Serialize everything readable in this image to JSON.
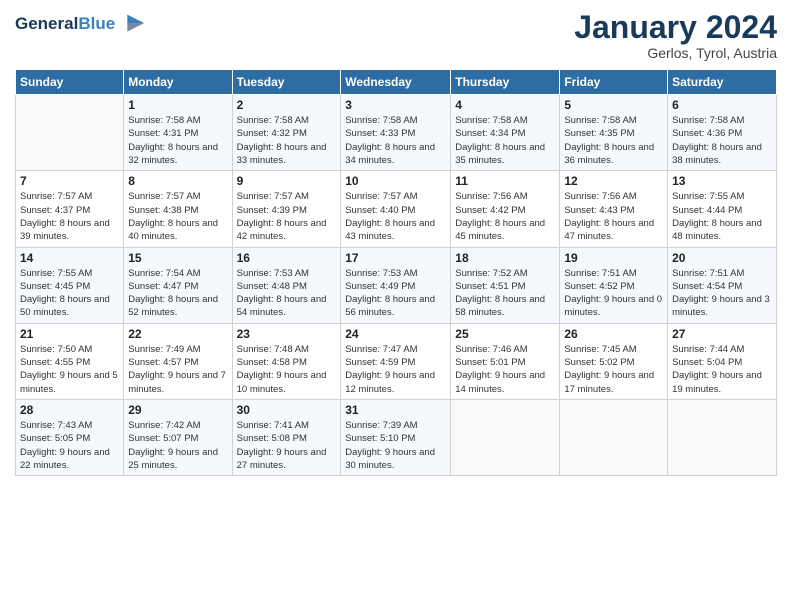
{
  "header": {
    "logo_line1": "General",
    "logo_line2": "Blue",
    "month": "January 2024",
    "location": "Gerlos, Tyrol, Austria"
  },
  "days_of_week": [
    "Sunday",
    "Monday",
    "Tuesday",
    "Wednesday",
    "Thursday",
    "Friday",
    "Saturday"
  ],
  "weeks": [
    [
      {
        "day": "",
        "sunrise": "",
        "sunset": "",
        "daylight": ""
      },
      {
        "day": "1",
        "sunrise": "Sunrise: 7:58 AM",
        "sunset": "Sunset: 4:31 PM",
        "daylight": "Daylight: 8 hours and 32 minutes."
      },
      {
        "day": "2",
        "sunrise": "Sunrise: 7:58 AM",
        "sunset": "Sunset: 4:32 PM",
        "daylight": "Daylight: 8 hours and 33 minutes."
      },
      {
        "day": "3",
        "sunrise": "Sunrise: 7:58 AM",
        "sunset": "Sunset: 4:33 PM",
        "daylight": "Daylight: 8 hours and 34 minutes."
      },
      {
        "day": "4",
        "sunrise": "Sunrise: 7:58 AM",
        "sunset": "Sunset: 4:34 PM",
        "daylight": "Daylight: 8 hours and 35 minutes."
      },
      {
        "day": "5",
        "sunrise": "Sunrise: 7:58 AM",
        "sunset": "Sunset: 4:35 PM",
        "daylight": "Daylight: 8 hours and 36 minutes."
      },
      {
        "day": "6",
        "sunrise": "Sunrise: 7:58 AM",
        "sunset": "Sunset: 4:36 PM",
        "daylight": "Daylight: 8 hours and 38 minutes."
      }
    ],
    [
      {
        "day": "7",
        "sunrise": "Sunrise: 7:57 AM",
        "sunset": "Sunset: 4:37 PM",
        "daylight": "Daylight: 8 hours and 39 minutes."
      },
      {
        "day": "8",
        "sunrise": "Sunrise: 7:57 AM",
        "sunset": "Sunset: 4:38 PM",
        "daylight": "Daylight: 8 hours and 40 minutes."
      },
      {
        "day": "9",
        "sunrise": "Sunrise: 7:57 AM",
        "sunset": "Sunset: 4:39 PM",
        "daylight": "Daylight: 8 hours and 42 minutes."
      },
      {
        "day": "10",
        "sunrise": "Sunrise: 7:57 AM",
        "sunset": "Sunset: 4:40 PM",
        "daylight": "Daylight: 8 hours and 43 minutes."
      },
      {
        "day": "11",
        "sunrise": "Sunrise: 7:56 AM",
        "sunset": "Sunset: 4:42 PM",
        "daylight": "Daylight: 8 hours and 45 minutes."
      },
      {
        "day": "12",
        "sunrise": "Sunrise: 7:56 AM",
        "sunset": "Sunset: 4:43 PM",
        "daylight": "Daylight: 8 hours and 47 minutes."
      },
      {
        "day": "13",
        "sunrise": "Sunrise: 7:55 AM",
        "sunset": "Sunset: 4:44 PM",
        "daylight": "Daylight: 8 hours and 48 minutes."
      }
    ],
    [
      {
        "day": "14",
        "sunrise": "Sunrise: 7:55 AM",
        "sunset": "Sunset: 4:45 PM",
        "daylight": "Daylight: 8 hours and 50 minutes."
      },
      {
        "day": "15",
        "sunrise": "Sunrise: 7:54 AM",
        "sunset": "Sunset: 4:47 PM",
        "daylight": "Daylight: 8 hours and 52 minutes."
      },
      {
        "day": "16",
        "sunrise": "Sunrise: 7:53 AM",
        "sunset": "Sunset: 4:48 PM",
        "daylight": "Daylight: 8 hours and 54 minutes."
      },
      {
        "day": "17",
        "sunrise": "Sunrise: 7:53 AM",
        "sunset": "Sunset: 4:49 PM",
        "daylight": "Daylight: 8 hours and 56 minutes."
      },
      {
        "day": "18",
        "sunrise": "Sunrise: 7:52 AM",
        "sunset": "Sunset: 4:51 PM",
        "daylight": "Daylight: 8 hours and 58 minutes."
      },
      {
        "day": "19",
        "sunrise": "Sunrise: 7:51 AM",
        "sunset": "Sunset: 4:52 PM",
        "daylight": "Daylight: 9 hours and 0 minutes."
      },
      {
        "day": "20",
        "sunrise": "Sunrise: 7:51 AM",
        "sunset": "Sunset: 4:54 PM",
        "daylight": "Daylight: 9 hours and 3 minutes."
      }
    ],
    [
      {
        "day": "21",
        "sunrise": "Sunrise: 7:50 AM",
        "sunset": "Sunset: 4:55 PM",
        "daylight": "Daylight: 9 hours and 5 minutes."
      },
      {
        "day": "22",
        "sunrise": "Sunrise: 7:49 AM",
        "sunset": "Sunset: 4:57 PM",
        "daylight": "Daylight: 9 hours and 7 minutes."
      },
      {
        "day": "23",
        "sunrise": "Sunrise: 7:48 AM",
        "sunset": "Sunset: 4:58 PM",
        "daylight": "Daylight: 9 hours and 10 minutes."
      },
      {
        "day": "24",
        "sunrise": "Sunrise: 7:47 AM",
        "sunset": "Sunset: 4:59 PM",
        "daylight": "Daylight: 9 hours and 12 minutes."
      },
      {
        "day": "25",
        "sunrise": "Sunrise: 7:46 AM",
        "sunset": "Sunset: 5:01 PM",
        "daylight": "Daylight: 9 hours and 14 minutes."
      },
      {
        "day": "26",
        "sunrise": "Sunrise: 7:45 AM",
        "sunset": "Sunset: 5:02 PM",
        "daylight": "Daylight: 9 hours and 17 minutes."
      },
      {
        "day": "27",
        "sunrise": "Sunrise: 7:44 AM",
        "sunset": "Sunset: 5:04 PM",
        "daylight": "Daylight: 9 hours and 19 minutes."
      }
    ],
    [
      {
        "day": "28",
        "sunrise": "Sunrise: 7:43 AM",
        "sunset": "Sunset: 5:05 PM",
        "daylight": "Daylight: 9 hours and 22 minutes."
      },
      {
        "day": "29",
        "sunrise": "Sunrise: 7:42 AM",
        "sunset": "Sunset: 5:07 PM",
        "daylight": "Daylight: 9 hours and 25 minutes."
      },
      {
        "day": "30",
        "sunrise": "Sunrise: 7:41 AM",
        "sunset": "Sunset: 5:08 PM",
        "daylight": "Daylight: 9 hours and 27 minutes."
      },
      {
        "day": "31",
        "sunrise": "Sunrise: 7:39 AM",
        "sunset": "Sunset: 5:10 PM",
        "daylight": "Daylight: 9 hours and 30 minutes."
      },
      {
        "day": "",
        "sunrise": "",
        "sunset": "",
        "daylight": ""
      },
      {
        "day": "",
        "sunrise": "",
        "sunset": "",
        "daylight": ""
      },
      {
        "day": "",
        "sunrise": "",
        "sunset": "",
        "daylight": ""
      }
    ]
  ]
}
